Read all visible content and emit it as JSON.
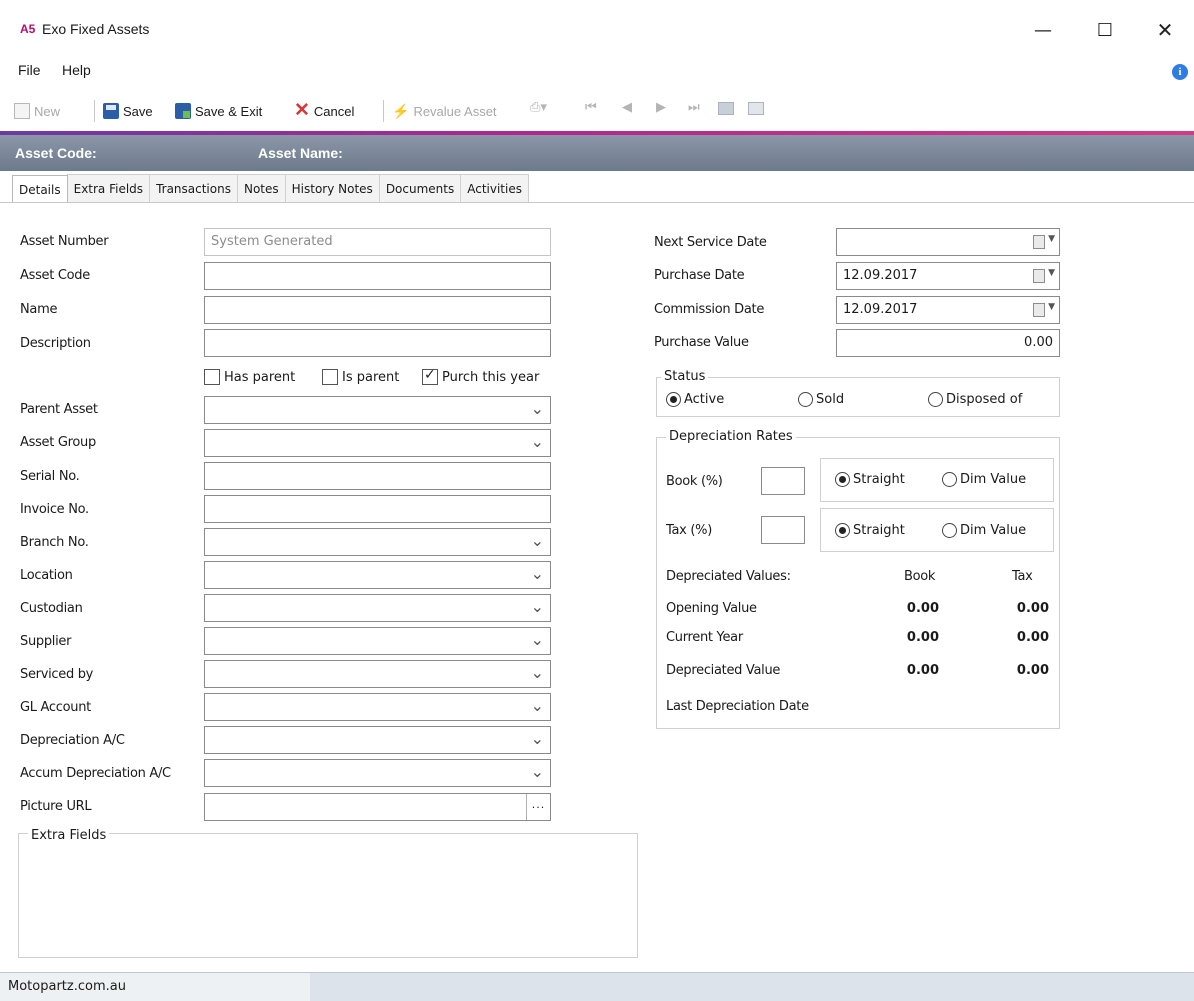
{
  "window": {
    "logo": "A5",
    "title": "Exo Fixed Assets",
    "minimize": "—",
    "maximize": "☐",
    "close": "✕"
  },
  "menu": {
    "file": "File",
    "help": "Help"
  },
  "toolbar": {
    "new_label": "New",
    "save_label": "Save",
    "save_exit_label": "Save & Exit",
    "cancel_label": "Cancel",
    "revalue_label": "Revalue Asset"
  },
  "header": {
    "asset_code_label": "Asset Code:",
    "asset_name_label": "Asset Name:"
  },
  "tabs": [
    "Details",
    "Extra Fields",
    "Transactions",
    "Notes",
    "History Notes",
    "Documents",
    "Activities"
  ],
  "left_form": {
    "asset_number_label": "Asset Number",
    "asset_number_value": "System Generated",
    "asset_code_label": "Asset Code",
    "name_label": "Name",
    "description_label": "Description",
    "has_parent_label": "Has parent",
    "is_parent_label": "Is parent",
    "purch_this_year_label": "Purch this year",
    "parent_asset_label": "Parent Asset",
    "asset_group_label": "Asset Group",
    "serial_no_label": "Serial No.",
    "invoice_no_label": "Invoice No.",
    "branch_no_label": "Branch No.",
    "location_label": "Location",
    "custodian_label": "Custodian",
    "supplier_label": "Supplier",
    "serviced_by_label": "Serviced by",
    "gl_account_label": "GL Account",
    "depreciation_ac_label": "Depreciation A/C",
    "accum_depreciation_ac_label": "Accum Depreciation A/C",
    "picture_url_label": "Picture URL",
    "picture_url_button": "···"
  },
  "checkboxes": {
    "has_parent": false,
    "is_parent": false,
    "purch_this_year": true
  },
  "right_form": {
    "next_service_date_label": "Next Service Date",
    "next_service_date_value": "",
    "purchase_date_label": "Purchase Date",
    "purchase_date_value": "12.09.2017",
    "commission_date_label": "Commission Date",
    "commission_date_value": "12.09.2017",
    "purchase_value_label": "Purchase Value",
    "purchase_value_value": "0.00"
  },
  "status": {
    "title": "Status",
    "active": "Active",
    "sold": "Sold",
    "disposed": "Disposed of",
    "selected": "Active"
  },
  "depreciation": {
    "title": "Depreciation Rates",
    "book_label": "Book (%)",
    "tax_label": "Tax (%)",
    "straight_label": "Straight",
    "dim_value_label": "Dim Value",
    "values_label": "Depreciated Values:",
    "book_col": "Book",
    "tax_col": "Tax",
    "rows": [
      {
        "label": "Opening Value",
        "book": "0.00",
        "tax": "0.00"
      },
      {
        "label": "Current Year",
        "book": "0.00",
        "tax": "0.00"
      },
      {
        "label": "Depreciated Value",
        "book": "0.00",
        "tax": "0.00"
      }
    ],
    "last_date_label": "Last Depreciation Date"
  },
  "extra_fields": {
    "title": "Extra Fields"
  },
  "statusbar": {
    "text": "Motopartz.com.au"
  },
  "colors": {
    "accent": "#b00e6e",
    "header_band": "#7b879a"
  }
}
